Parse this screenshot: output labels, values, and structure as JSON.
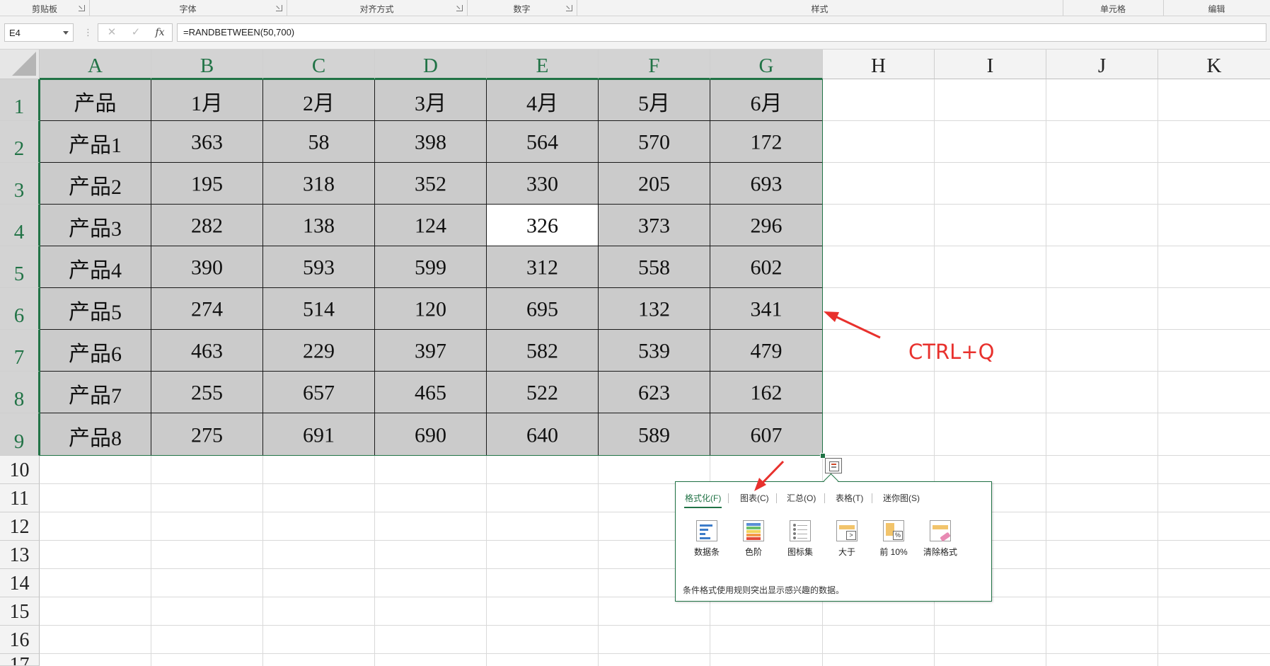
{
  "ribbon": {
    "groups": [
      {
        "label": "剪贴板"
      },
      {
        "label": "字体"
      },
      {
        "label": "对齐方式"
      },
      {
        "label": "数字"
      },
      {
        "label": "样式"
      },
      {
        "label": "单元格"
      },
      {
        "label": "编辑"
      }
    ]
  },
  "formula_bar": {
    "name_box": "E4",
    "cancel_symbol": "✕",
    "enter_symbol": "✓",
    "fx_symbol": "fx",
    "formula": "=RANDBETWEEN(50,700)"
  },
  "sheet": {
    "columns": [
      "A",
      "B",
      "C",
      "D",
      "E",
      "F",
      "G",
      "H",
      "I",
      "J",
      "K"
    ],
    "rows": [
      "1",
      "2",
      "3",
      "4",
      "5",
      "6",
      "7",
      "8",
      "9",
      "10",
      "11",
      "12",
      "13",
      "14",
      "15",
      "16",
      "17"
    ],
    "selected_columns": [
      "A",
      "B",
      "C",
      "D",
      "E",
      "F",
      "G"
    ],
    "selected_rows": [
      "1",
      "2",
      "3",
      "4",
      "5",
      "6",
      "7",
      "8",
      "9"
    ],
    "active_cell": "E4",
    "header": [
      "产品",
      "1月",
      "2月",
      "3月",
      "4月",
      "5月",
      "6月"
    ],
    "data": [
      [
        "产品1",
        "363",
        "58",
        "398",
        "564",
        "570",
        "172"
      ],
      [
        "产品2",
        "195",
        "318",
        "352",
        "330",
        "205",
        "693"
      ],
      [
        "产品3",
        "282",
        "138",
        "124",
        "326",
        "373",
        "296"
      ],
      [
        "产品4",
        "390",
        "593",
        "599",
        "312",
        "558",
        "602"
      ],
      [
        "产品5",
        "274",
        "514",
        "120",
        "695",
        "132",
        "341"
      ],
      [
        "产品6",
        "463",
        "229",
        "397",
        "582",
        "539",
        "479"
      ],
      [
        "产品7",
        "255",
        "657",
        "465",
        "522",
        "623",
        "162"
      ],
      [
        "产品8",
        "275",
        "691",
        "690",
        "640",
        "589",
        "607"
      ]
    ]
  },
  "quick_analysis": {
    "tabs": [
      {
        "label": "格式化(F)",
        "active": true
      },
      {
        "label": "图表(C)",
        "active": false
      },
      {
        "label": "汇总(O)",
        "active": false
      },
      {
        "label": "表格(T)",
        "active": false
      },
      {
        "label": "迷你图(S)",
        "active": false
      }
    ],
    "items": [
      {
        "label": "数据条",
        "icon": "data-bars-icon"
      },
      {
        "label": "色阶",
        "icon": "color-scale-icon"
      },
      {
        "label": "图标集",
        "icon": "icon-set-icon"
      },
      {
        "label": "大于",
        "icon": "greater-than-icon",
        "glyph": ">"
      },
      {
        "label": "前 10%",
        "icon": "top-10-percent-icon",
        "glyph": "%"
      },
      {
        "label": "清除格式",
        "icon": "clear-format-icon"
      }
    ],
    "description": "条件格式使用规则突出显示感兴趣的数据。"
  },
  "annotation": {
    "text": "CTRL+Q",
    "color": "#e8312d"
  },
  "colors": {
    "accent": "#217346",
    "selection_fill": "#cbcbcb"
  }
}
